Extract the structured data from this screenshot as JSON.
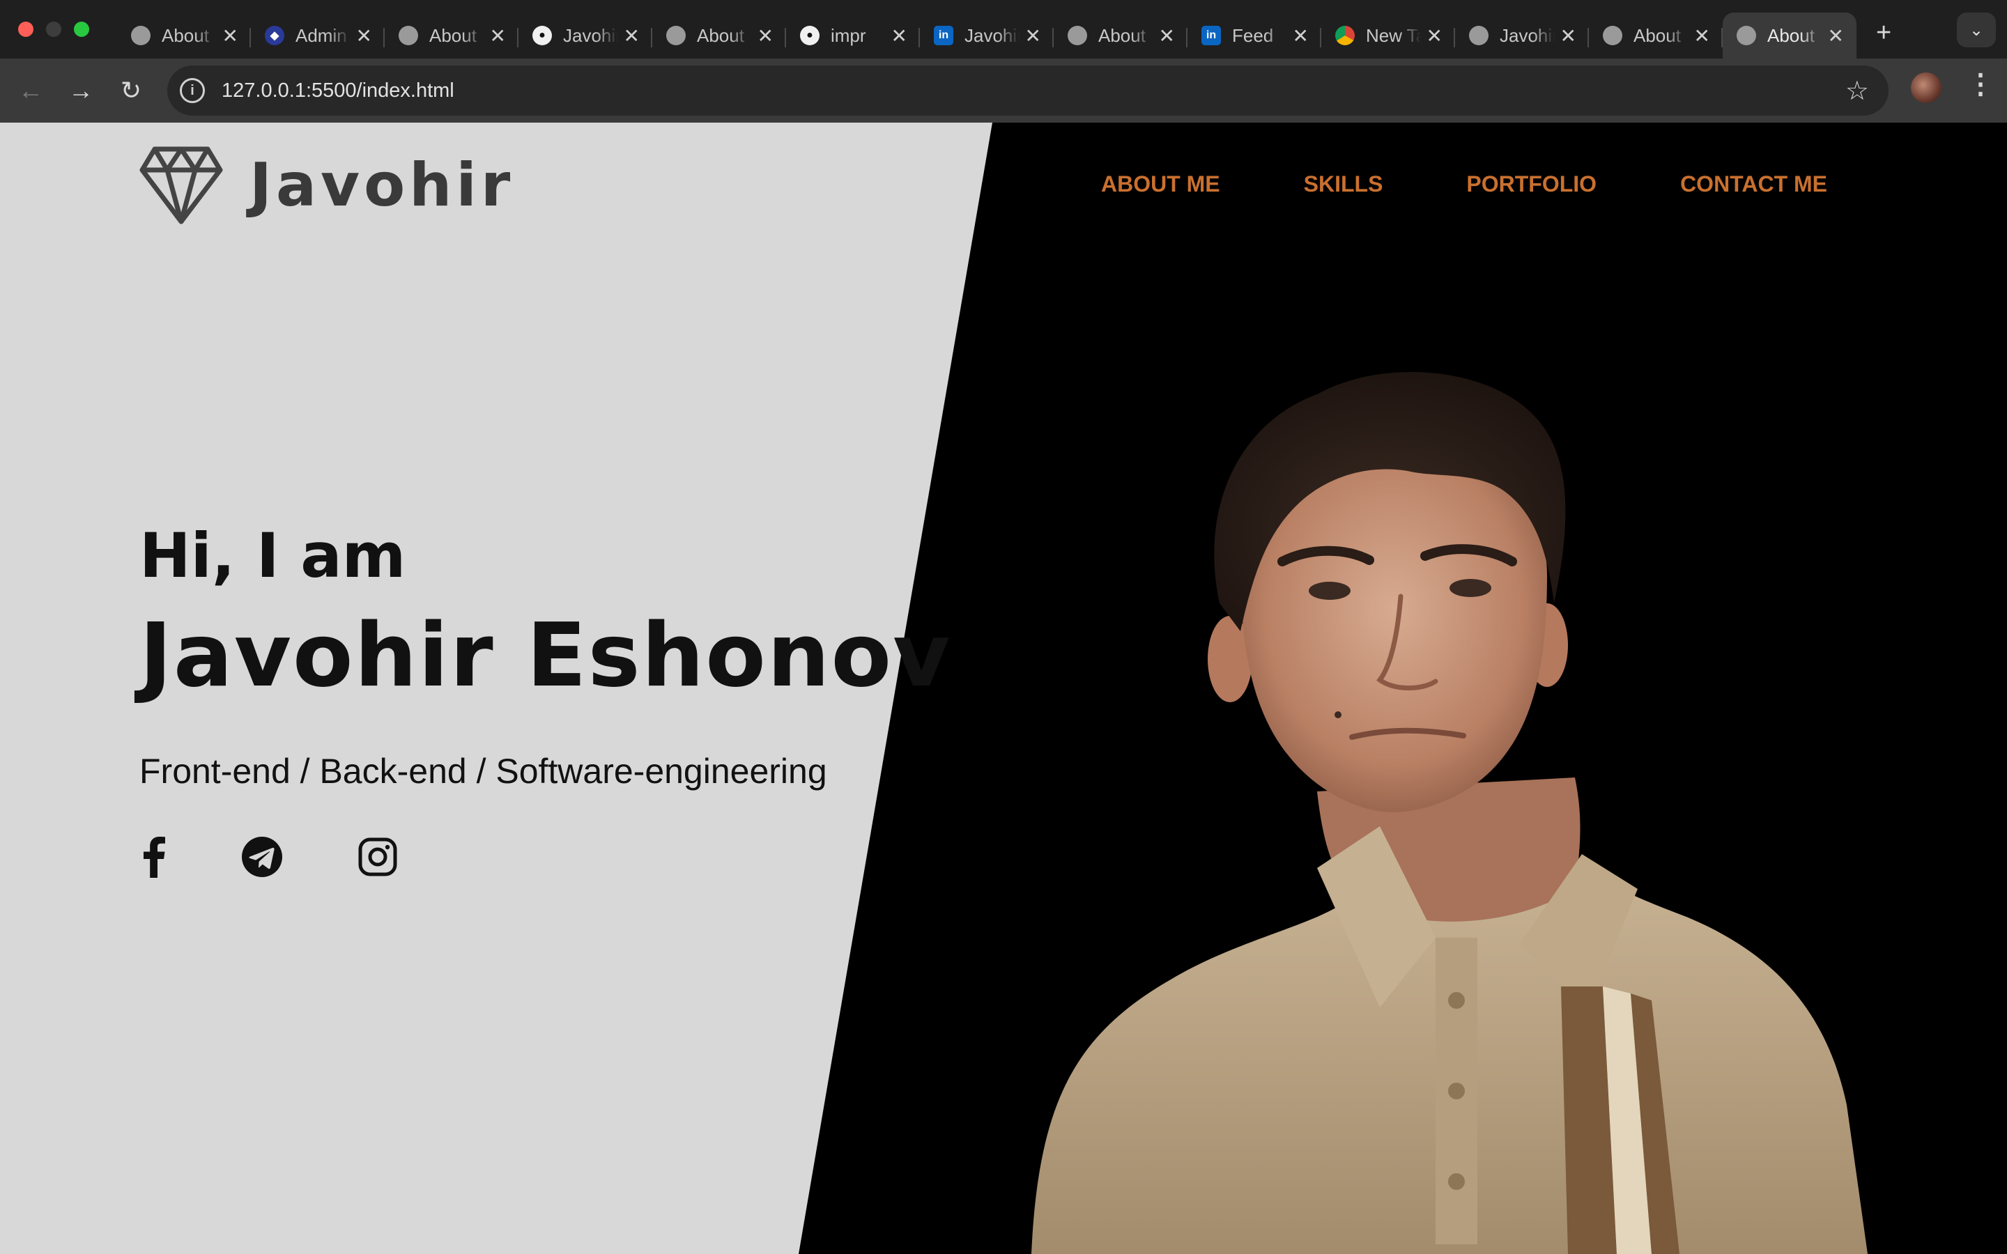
{
  "browser": {
    "tabs": [
      {
        "title": "About",
        "favicon": "globe-icon"
      },
      {
        "title": "Admin",
        "favicon": "admin-icon"
      },
      {
        "title": "About",
        "favicon": "globe-icon"
      },
      {
        "title": "Javohir",
        "favicon": "github-icon"
      },
      {
        "title": "About",
        "favicon": "globe-icon"
      },
      {
        "title": "impr",
        "favicon": "github-icon"
      },
      {
        "title": "Javohir",
        "favicon": "linkedin-icon"
      },
      {
        "title": "About",
        "favicon": "globe-icon"
      },
      {
        "title": "Feed",
        "favicon": "linkedin-icon"
      },
      {
        "title": "New Tab",
        "favicon": "chrome-icon"
      },
      {
        "title": "Javohir",
        "favicon": "globe-icon"
      },
      {
        "title": "About",
        "favicon": "globe-icon"
      },
      {
        "title": "About",
        "favicon": "globe-icon",
        "active": true
      }
    ],
    "url": "127.0.0.1:5500/index.html"
  },
  "site": {
    "logo_text": "Javohir",
    "nav": [
      "ABOUT ME",
      "SKILLS",
      "PORTFOLIO",
      "CONTACT ME"
    ],
    "greeting": "Hi, I am",
    "name": "Javohir Eshonov",
    "role": "Front-end / Back-end / Software-engineering",
    "socials": [
      "facebook-icon",
      "telegram-icon",
      "instagram-icon"
    ]
  },
  "colors": {
    "accent": "#c9702f",
    "left_bg": "#d8d8d8",
    "right_bg": "#000000"
  }
}
